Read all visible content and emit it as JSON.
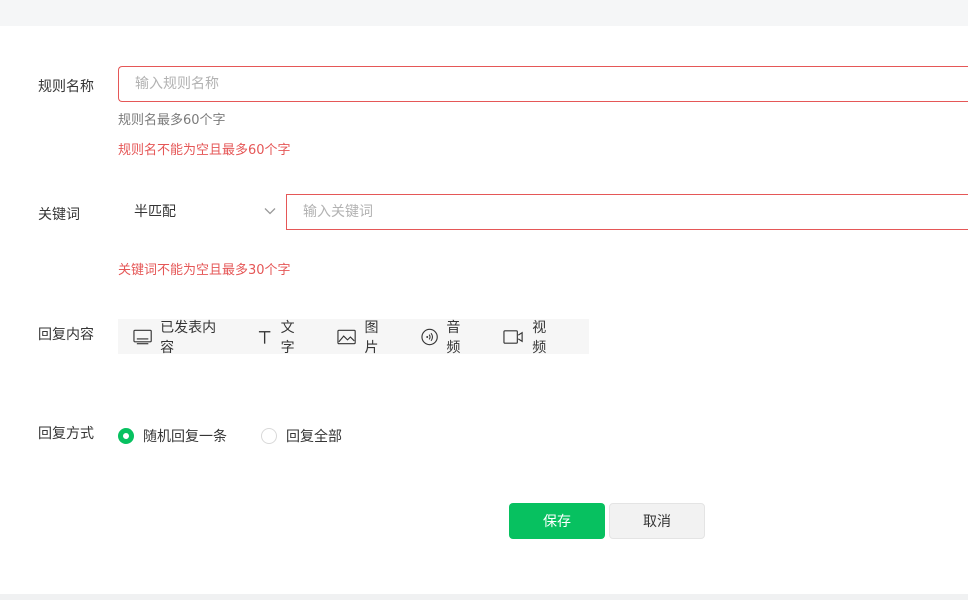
{
  "form": {
    "rule_name": {
      "label": "规则名称",
      "placeholder": "输入规则名称",
      "value": "",
      "hint": "规则名最多60个字",
      "error": "规则名不能为空且最多60个字"
    },
    "keyword": {
      "label": "关键词",
      "match_mode": "半匹配",
      "placeholder": "输入关键词",
      "value": "",
      "error": "关键词不能为空且最多30个字"
    },
    "reply_content": {
      "label": "回复内容",
      "types": [
        {
          "label": "已发表内容",
          "icon": "published-content-icon"
        },
        {
          "label": "文字",
          "icon": "text-icon"
        },
        {
          "label": "图片",
          "icon": "image-icon"
        },
        {
          "label": "音频",
          "icon": "audio-icon"
        },
        {
          "label": "视频",
          "icon": "video-icon"
        }
      ]
    },
    "reply_mode": {
      "label": "回复方式",
      "options": [
        {
          "label": "随机回复一条",
          "selected": true
        },
        {
          "label": "回复全部",
          "selected": false
        }
      ]
    }
  },
  "actions": {
    "save_label": "保存",
    "cancel_label": "取消"
  },
  "colors": {
    "accent": "#07c160",
    "error": "#e55757"
  }
}
